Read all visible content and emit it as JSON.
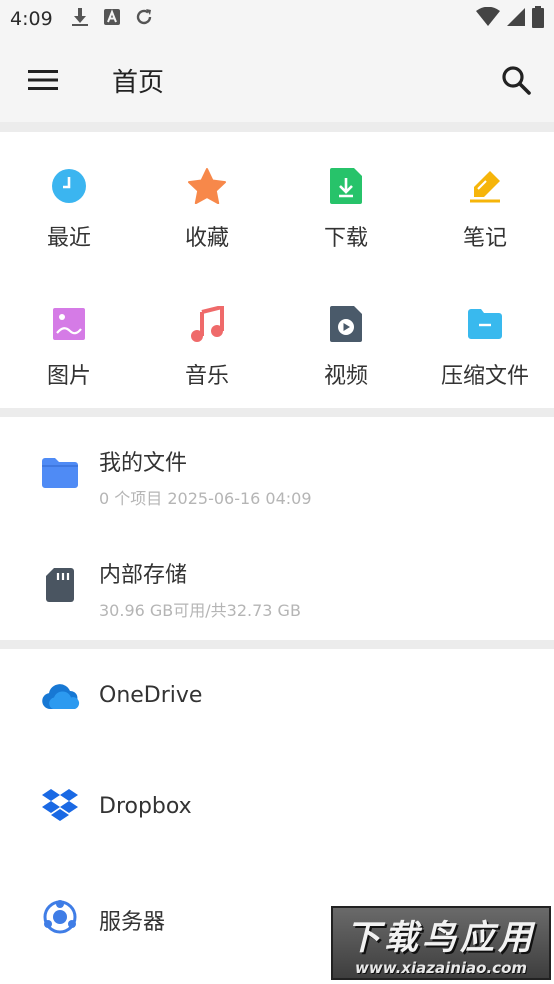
{
  "status": {
    "time": "4:09"
  },
  "appbar": {
    "title": "首页"
  },
  "categories": [
    {
      "label": "最近",
      "icon": "clock-icon"
    },
    {
      "label": "收藏",
      "icon": "star-icon"
    },
    {
      "label": "下载",
      "icon": "download-icon"
    },
    {
      "label": "笔记",
      "icon": "pencil-icon"
    },
    {
      "label": "图片",
      "icon": "image-icon"
    },
    {
      "label": "音乐",
      "icon": "music-icon"
    },
    {
      "label": "视频",
      "icon": "video-icon"
    },
    {
      "label": "压缩文件",
      "icon": "archive-icon"
    }
  ],
  "storage": [
    {
      "title": "我的文件",
      "subtitle": "0 个项目 2025-06-16 04:09"
    },
    {
      "title": "内部存储",
      "subtitle": "30.96 GB可用/共32.73 GB"
    }
  ],
  "cloud": [
    {
      "title": "OneDrive"
    },
    {
      "title": "Dropbox"
    },
    {
      "title": "服务器"
    }
  ],
  "watermark": {
    "line1": "下载鸟应用",
    "line2": "www.xiazainiao.com"
  },
  "colors": {
    "clock": "#3bb5f0",
    "star": "#f7884a",
    "download": "#27c36a",
    "pencil": "#f6b50a",
    "image": "#d57be6",
    "music": "#ef6a6a",
    "video": "#4a5a6a",
    "archive": "#39b9ee",
    "folder": "#4f8bf5",
    "sdcard": "#4a5561",
    "onedrive": "#1778d4",
    "dropbox": "#1a69e4",
    "server": "#3f7de6"
  }
}
